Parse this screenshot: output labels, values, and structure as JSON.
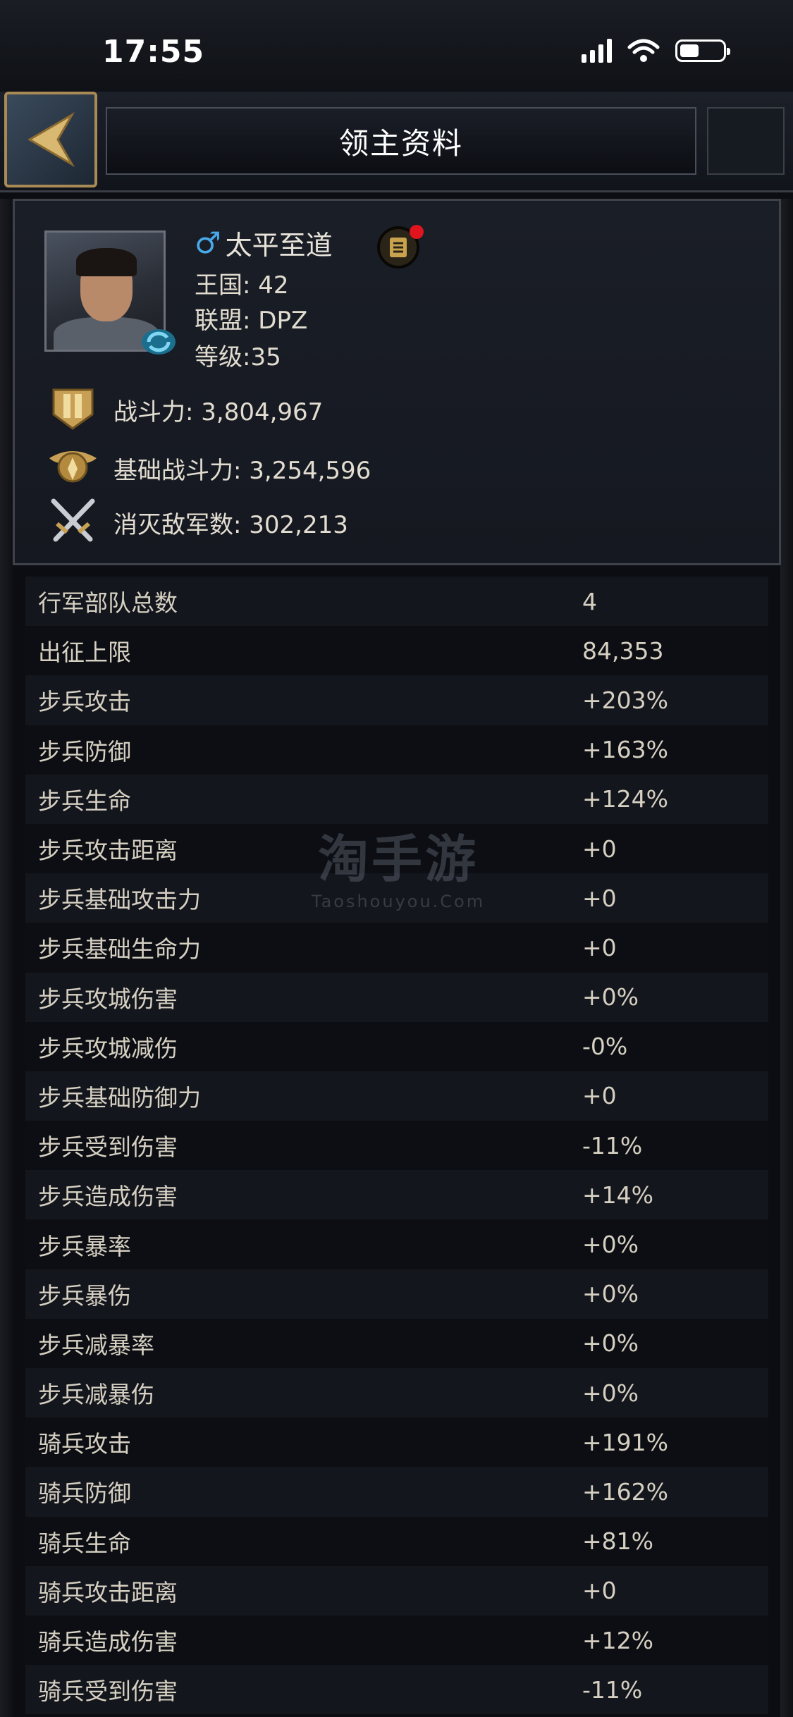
{
  "status_bar": {
    "time": "17:55"
  },
  "header": {
    "title": "领主资料"
  },
  "profile": {
    "gender_symbol": "♂",
    "name": "太平至道",
    "kingdom": "王国:  42",
    "alliance": "联盟:  DPZ",
    "level": "等级:35",
    "power": "战斗力: 3,804,967",
    "base_power": "基础战斗力: 3,254,596",
    "kills": "消灭敌军数: 302,213"
  },
  "watermark": {
    "title": "淘手游",
    "subtitle": "Taoshouyou.Com"
  },
  "stats": [
    {
      "label": "行军部队总数",
      "value": "4"
    },
    {
      "label": "出征上限",
      "value": "84,353"
    },
    {
      "label": "步兵攻击",
      "value": "+203%"
    },
    {
      "label": "步兵防御",
      "value": "+163%"
    },
    {
      "label": "步兵生命",
      "value": "+124%"
    },
    {
      "label": "步兵攻击距离",
      "value": "+0"
    },
    {
      "label": "步兵基础攻击力",
      "value": "+0"
    },
    {
      "label": "步兵基础生命力",
      "value": "+0"
    },
    {
      "label": "步兵攻城伤害",
      "value": "+0%"
    },
    {
      "label": "步兵攻城减伤",
      "value": "-0%"
    },
    {
      "label": "步兵基础防御力",
      "value": "+0"
    },
    {
      "label": "步兵受到伤害",
      "value": "-11%"
    },
    {
      "label": "步兵造成伤害",
      "value": "+14%"
    },
    {
      "label": "步兵暴率",
      "value": "+0%"
    },
    {
      "label": "步兵暴伤",
      "value": "+0%"
    },
    {
      "label": "步兵减暴率",
      "value": "+0%"
    },
    {
      "label": "步兵减暴伤",
      "value": "+0%"
    },
    {
      "label": "骑兵攻击",
      "value": "+191%"
    },
    {
      "label": "骑兵防御",
      "value": "+162%"
    },
    {
      "label": "骑兵生命",
      "value": "+81%"
    },
    {
      "label": "骑兵攻击距离",
      "value": "+0"
    },
    {
      "label": "骑兵造成伤害",
      "value": "+12%"
    },
    {
      "label": "骑兵受到伤害",
      "value": "-11%"
    }
  ]
}
